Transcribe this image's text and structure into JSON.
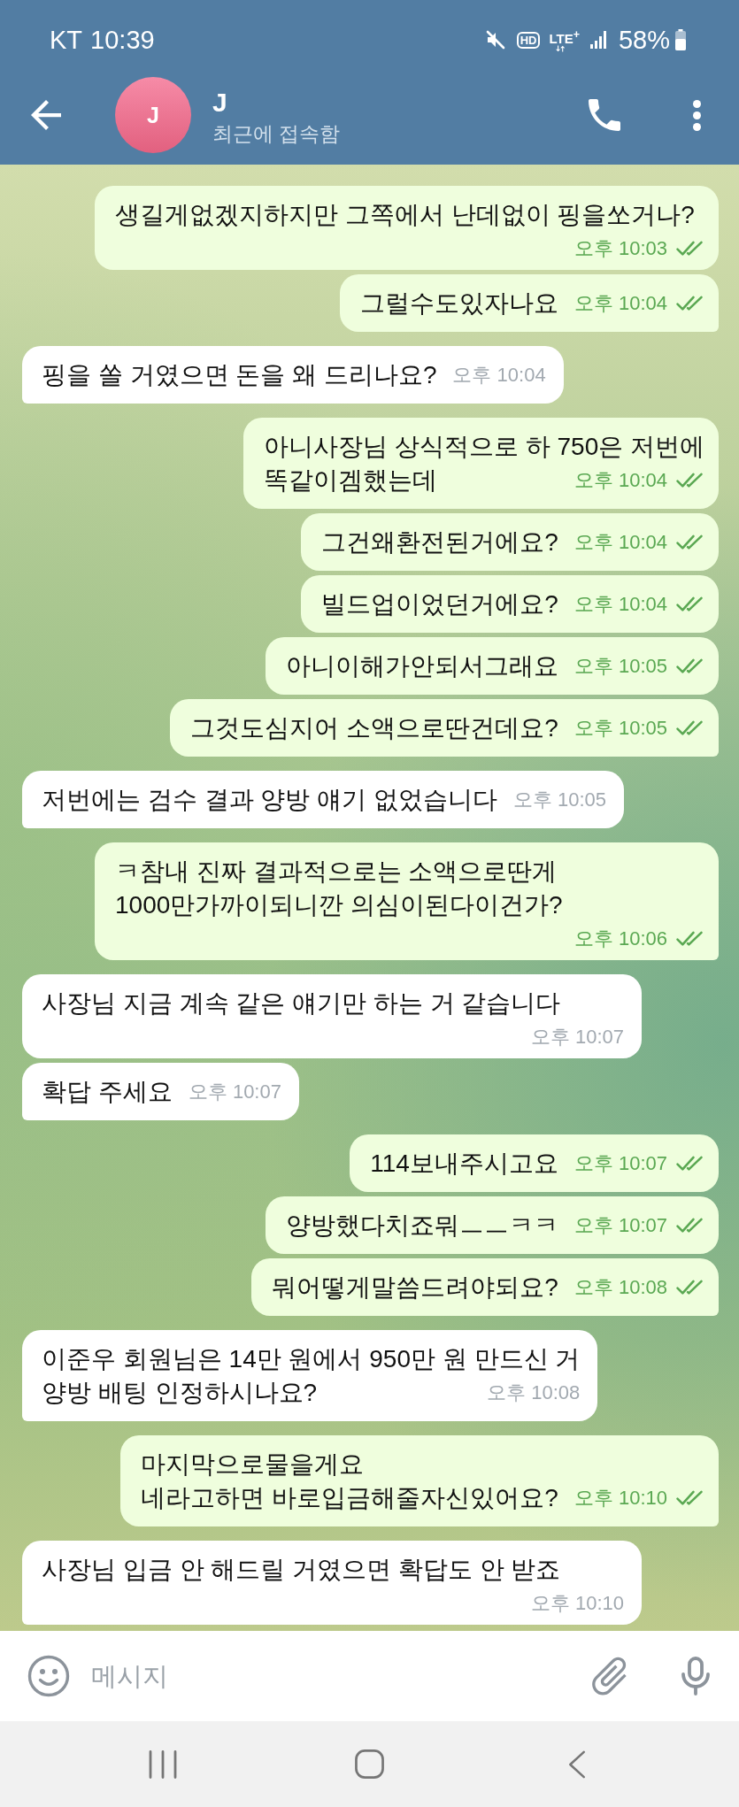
{
  "status_bar": {
    "carrier": "KT",
    "time": "10:39",
    "hd_badge": "HD",
    "network": "LTE$^{+}$",
    "battery": "58%"
  },
  "header": {
    "avatar_initial": "J",
    "name": "J",
    "last_seen": "최근에 접속함"
  },
  "messages": [
    {
      "kind": "outgoing",
      "text": "생길게없겠지하지만 그쪽에서 난데없이 핑을쏘거나?",
      "time": "오후 10:03",
      "read": true
    },
    {
      "kind": "outgoing",
      "text": "그럴수도있자나요",
      "time": "오후 10:04",
      "read": true
    },
    {
      "kind": "incoming",
      "text": "핑을 쏠 거였으면 돈을 왜 드리나요?",
      "time": "오후 10:04"
    },
    {
      "kind": "outgoing",
      "text": "아니사장님 상식적으로 하 750은 저번에\n똑같이겜했는데",
      "time": "오후 10:04",
      "read": true
    },
    {
      "kind": "outgoing",
      "text": "그건왜환전된거에요?",
      "time": "오후 10:04",
      "read": true
    },
    {
      "kind": "outgoing",
      "text": "빌드업이었던거에요?",
      "time": "오후 10:04",
      "read": true
    },
    {
      "kind": "outgoing",
      "text": "아니이해가안되서그래요",
      "time": "오후 10:05",
      "read": true
    },
    {
      "kind": "outgoing",
      "text": "그것도심지어 소액으로딴건데요?",
      "time": "오후 10:05",
      "read": true
    },
    {
      "kind": "incoming",
      "text": "저번에는 검수 결과 양방 얘기 없었습니다",
      "time": "오후 10:05"
    },
    {
      "kind": "outgoing",
      "text": "ㅋ참내 진짜 결과적으로는 소액으로딴게\n1000만가까이되니깐 의심이된다이건가?",
      "time": "오후 10:06",
      "read": true
    },
    {
      "kind": "incoming",
      "text": "사장님 지금 계속 같은 얘기만 하는 거 같습니다",
      "time": "오후 10:07"
    },
    {
      "kind": "incoming",
      "text": "확답 주세요",
      "time": "오후 10:07"
    },
    {
      "kind": "outgoing",
      "text": "114보내주시고요",
      "time": "오후 10:07",
      "read": true
    },
    {
      "kind": "outgoing",
      "text": "양방했다치죠뭐ㅡㅡㅋㅋ",
      "time": "오후 10:07",
      "read": true
    },
    {
      "kind": "outgoing",
      "text": "뭐어떻게말씀드려야되요?",
      "time": "오후 10:08",
      "read": true
    },
    {
      "kind": "incoming",
      "text": "이준우 회원님은 14만 원에서 950만 원 만드신 거\n양방 배팅 인정하시나요?",
      "time": "오후 10:08"
    },
    {
      "kind": "outgoing",
      "text": "마지막으로물을게요\n네라고하면 바로입금해줄자신있어요?",
      "time": "오후 10:10",
      "read": true
    },
    {
      "kind": "incoming",
      "text": "사장님 입금 안 해드릴 거였으면 확답도 안 받죠",
      "time": "오후 10:10"
    }
  ],
  "composer": {
    "placeholder": "메시지"
  }
}
